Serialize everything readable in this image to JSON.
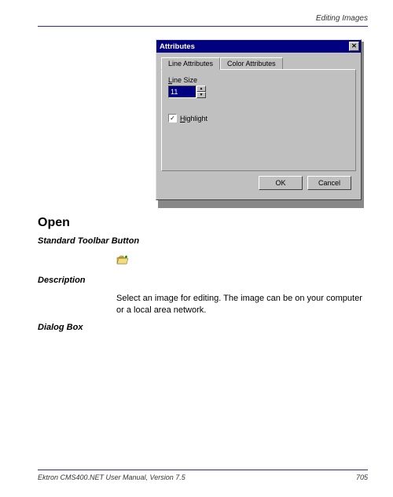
{
  "header": {
    "section_title": "Editing Images"
  },
  "dialog": {
    "title": "Attributes",
    "tabs": {
      "active": "Line Attributes",
      "inactive": "Color Attributes"
    },
    "line_size": {
      "label_prefix": "L",
      "label_rest": "ine Size",
      "value": "11"
    },
    "highlight": {
      "checked": "✓",
      "label_prefix": "H",
      "label_rest": "ighlight"
    },
    "buttons": {
      "ok": "OK",
      "cancel": "Cancel"
    }
  },
  "content": {
    "heading": "Open",
    "sub_toolbar": "Standard Toolbar Button",
    "sub_description": "Description",
    "description_text": "Select an image for editing. The image can be on your computer or a local area network.",
    "sub_dialog": "Dialog Box"
  },
  "footer": {
    "manual": "Ektron CMS400.NET User Manual, Version 7.5",
    "page": "705"
  }
}
